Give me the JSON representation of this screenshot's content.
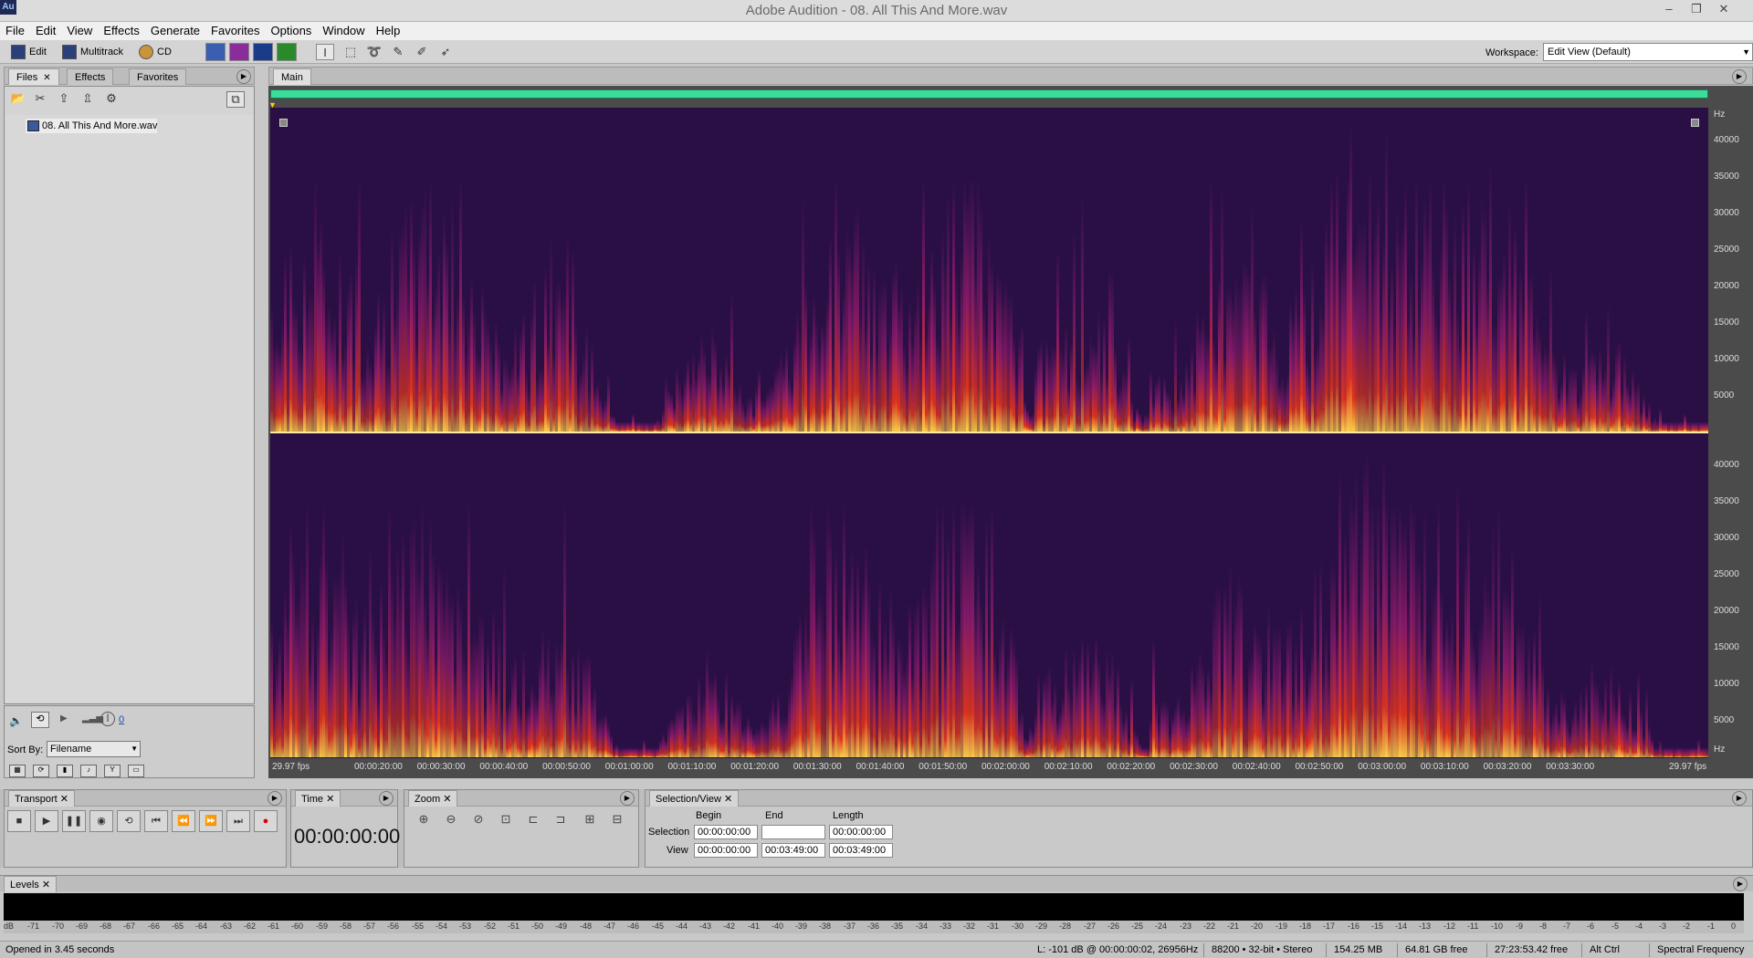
{
  "window": {
    "app_icon": "Au",
    "title": "Adobe Audition - 08. All This And More.wav",
    "controls": [
      "minimize-icon",
      "restore-icon",
      "close-icon"
    ]
  },
  "menu": [
    "File",
    "Edit",
    "View",
    "Effects",
    "Generate",
    "Favorites",
    "Options",
    "Window",
    "Help"
  ],
  "toolbar": {
    "edit_label": "Edit",
    "multitrack_label": "Multitrack",
    "cd_label": "CD",
    "workspace_label": "Workspace:",
    "workspace_value": "Edit View (Default)"
  },
  "files_panel": {
    "tabs": [
      "Files",
      "Effects",
      "Favorites"
    ],
    "active_tab": "Files",
    "file_item": "08. All This And More.wav",
    "footer_value": "0",
    "sort_by_label": "Sort By:",
    "sort_by_value": "Filename"
  },
  "main_panel": {
    "tab": "Main",
    "hz_axis_top": [
      "Hz",
      "40000",
      "35000",
      "30000",
      "25000",
      "20000",
      "15000",
      "10000",
      "5000"
    ],
    "hz_axis_bottom": [
      "40000",
      "35000",
      "30000",
      "25000",
      "20000",
      "15000",
      "10000",
      "5000",
      "Hz"
    ],
    "time_start_label": "29.97 fps",
    "time_end_label": "29.97 fps",
    "time_ticks": [
      "00:00:20:00",
      "00:00:30:00",
      "00:00:40:00",
      "00:00:50:00",
      "00:01:00:00",
      "00:01:10:00",
      "00:01:20:00",
      "00:01:30:00",
      "00:01:40:00",
      "00:01:50:00",
      "00:02:00:00",
      "00:02:10:00",
      "00:02:20:00",
      "00:02:30:00",
      "00:02:40:00",
      "00:02:50:00",
      "00:03:00:00",
      "00:03:10:00",
      "00:03:20:00",
      "00:03:30:00"
    ]
  },
  "transport": {
    "tab": "Transport"
  },
  "time_panel": {
    "tab": "Time",
    "display": "00:00:00:00"
  },
  "zoom_panel": {
    "tab": "Zoom"
  },
  "selection_view": {
    "tab": "Selection/View",
    "begin_header": "Begin",
    "end_header": "End",
    "length_header": "Length",
    "selection_label": "Selection",
    "view_label": "View",
    "selection_begin": "00:00:00:00",
    "selection_end": "",
    "selection_length": "00:00:00:00",
    "view_begin": "00:00:00:00",
    "view_end": "00:03:49:00",
    "view_length": "00:03:49:00"
  },
  "levels": {
    "tab": "Levels",
    "scale": [
      "dB",
      "-71",
      "-70",
      "-69",
      "-68",
      "-67",
      "-66",
      "-65",
      "-64",
      "-63",
      "-62",
      "-61",
      "-60",
      "-59",
      "-58",
      "-57",
      "-56",
      "-55",
      "-54",
      "-53",
      "-52",
      "-51",
      "-50",
      "-49",
      "-48",
      "-47",
      "-46",
      "-45",
      "-44",
      "-43",
      "-42",
      "-41",
      "-40",
      "-39",
      "-38",
      "-37",
      "-36",
      "-35",
      "-34",
      "-33",
      "-32",
      "-31",
      "-30",
      "-29",
      "-28",
      "-27",
      "-26",
      "-25",
      "-24",
      "-23",
      "-22",
      "-21",
      "-20",
      "-19",
      "-18",
      "-17",
      "-16",
      "-15",
      "-14",
      "-13",
      "-12",
      "-11",
      "-10",
      "-9",
      "-8",
      "-7",
      "-6",
      "-5",
      "-4",
      "-3",
      "-2",
      "-1",
      "0"
    ]
  },
  "status": {
    "message": "Opened in 3.45 seconds",
    "cursor": "L: -101 dB @ 00:00:00:02, 26956Hz",
    "format": "88200 • 32-bit • Stereo",
    "file_size": "154.25 MB",
    "disk_free": "64.81 GB free",
    "time_free": "27:23:53.42 free",
    "keys": "Alt Ctrl",
    "view_mode": "Spectral Frequency"
  },
  "colors": {
    "spectrogram_background": "#2a0f45",
    "spectrogram_hot": "#ffd24a",
    "spectrogram_mid": "#e0341c",
    "overview_bar": "#3ddc9a"
  }
}
